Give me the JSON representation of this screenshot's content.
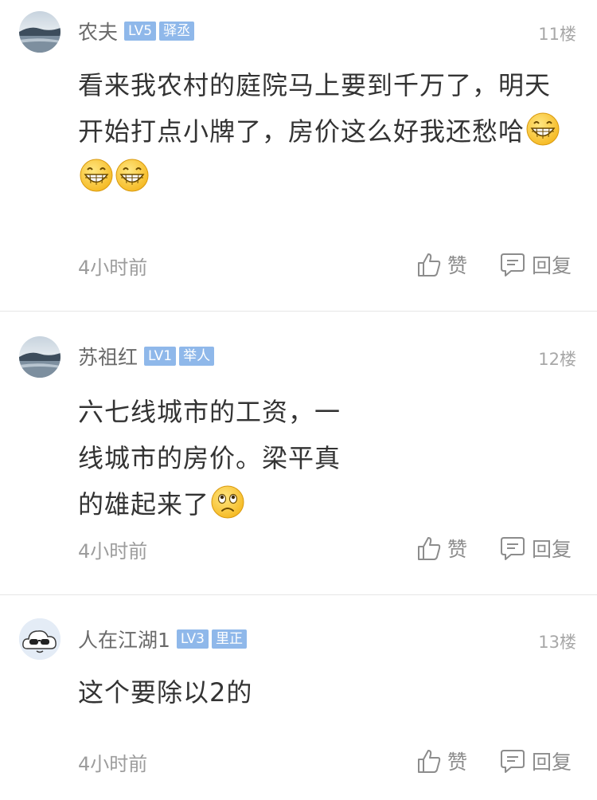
{
  "comments": [
    {
      "username": "农夫",
      "level": "LV5",
      "title": "驿丞",
      "floor": "11楼",
      "content": "看来我农村的庭院马上要到千万了，明天开始打点小牌了，房价这么好我还愁哈",
      "emojis": [
        "grin-emoji",
        "grin-emoji",
        "grin-emoji"
      ],
      "time": "4小时前",
      "like_label": "赞",
      "reply_label": "回复",
      "avatar": "landscape-avatar"
    },
    {
      "username": "苏祖红",
      "level": "LV1",
      "title": "举人",
      "floor": "12楼",
      "content": "六七线城市的工资，一线城市的房价。梁平真的雄起来了",
      "emojis": [
        "sad-emoji"
      ],
      "time": "4小时前",
      "like_label": "赞",
      "reply_label": "回复",
      "avatar": "landscape-avatar"
    },
    {
      "username": "人在江湖1",
      "level": "LV3",
      "title": "里正",
      "floor": "13楼",
      "content": "这个要除以2的",
      "emojis": [],
      "time": "4小时前",
      "like_label": "赞",
      "reply_label": "回复",
      "avatar": "cloud-sunglasses-avatar"
    }
  ],
  "colors": {
    "badge": "#8fb8ea",
    "text": "#333333",
    "meta": "#9c9c9c"
  }
}
